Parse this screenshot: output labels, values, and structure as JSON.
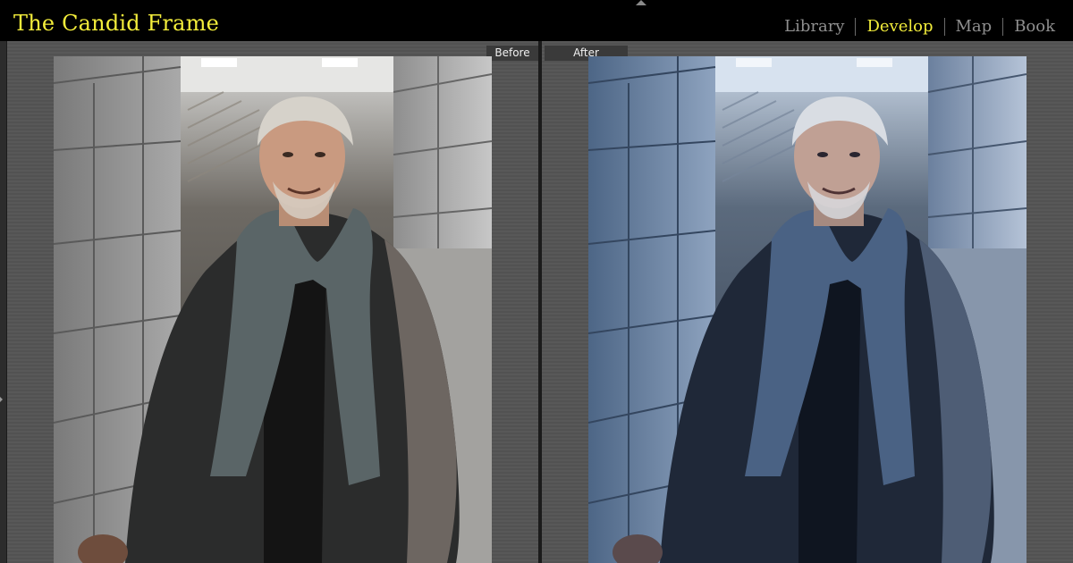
{
  "app": {
    "logo": "The Candid Frame"
  },
  "modules": [
    {
      "label": "Library",
      "active": false
    },
    {
      "label": "Develop",
      "active": true
    },
    {
      "label": "Map",
      "active": false
    },
    {
      "label": "Book",
      "active": false
    }
  ],
  "panes": {
    "before_label": "Before",
    "after_label": "After"
  },
  "colors": {
    "accent": "#f3ed3b",
    "inactive_module": "#8f8f8f",
    "background": "#000000",
    "panel": "#555555"
  },
  "icons": {
    "collapse_top": "triangle-up-icon",
    "collapse_left": "triangle-right-icon"
  }
}
